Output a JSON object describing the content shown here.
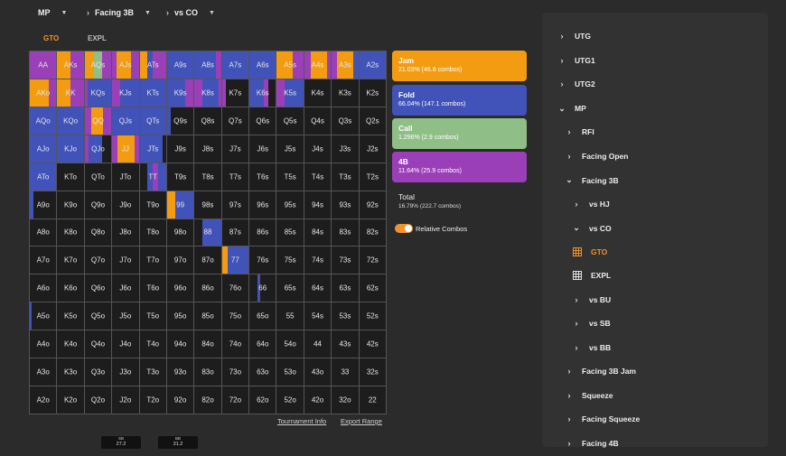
{
  "header": {
    "position": "MP",
    "scenario": "Facing 3B",
    "villain": "vs CO"
  },
  "tabs": [
    {
      "label": "GTO",
      "active": true
    },
    {
      "label": "EXPL",
      "active": false
    }
  ],
  "grid": {
    "rows": [
      [
        "AA",
        "AKs",
        "AQs",
        "AJs",
        "ATs",
        "A9s",
        "A8s",
        "A7s",
        "A6s",
        "A5s",
        "A4s",
        "A3s",
        "A2s"
      ],
      [
        "AKo",
        "KK",
        "KQs",
        "KJs",
        "KTs",
        "K9s",
        "K8s",
        "K7s",
        "K6s",
        "K5s",
        "K4s",
        "K3s",
        "K2s"
      ],
      [
        "AQo",
        "KQo",
        "QQ",
        "QJs",
        "QTs",
        "Q9s",
        "Q8s",
        "Q7s",
        "Q6s",
        "Q5s",
        "Q4s",
        "Q3s",
        "Q2s"
      ],
      [
        "AJo",
        "KJo",
        "QJo",
        "JJ",
        "JTs",
        "J9s",
        "J8s",
        "J7s",
        "J6s",
        "J5s",
        "J4s",
        "J3s",
        "J2s"
      ],
      [
        "ATo",
        "KTo",
        "QTo",
        "JTo",
        "TT",
        "T9s",
        "T8s",
        "T7s",
        "T6s",
        "T5s",
        "T4s",
        "T3s",
        "T2s"
      ],
      [
        "A9o",
        "K9o",
        "Q9o",
        "J9o",
        "T9o",
        "99",
        "98s",
        "97s",
        "96s",
        "95s",
        "94s",
        "93s",
        "92s"
      ],
      [
        "A8o",
        "K8o",
        "Q8o",
        "J8o",
        "T8o",
        "98o",
        "88",
        "87s",
        "86s",
        "85s",
        "84s",
        "83s",
        "82s"
      ],
      [
        "A7o",
        "K7o",
        "Q7o",
        "J7o",
        "T7o",
        "97o",
        "87o",
        "77",
        "76s",
        "75s",
        "74s",
        "73s",
        "72s"
      ],
      [
        "A6o",
        "K6o",
        "Q6o",
        "J6o",
        "T6o",
        "96o",
        "86o",
        "76o",
        "66",
        "65s",
        "64s",
        "63s",
        "62s"
      ],
      [
        "A5o",
        "K5o",
        "Q5o",
        "J5o",
        "T5o",
        "95o",
        "85o",
        "75o",
        "65o",
        "55",
        "54s",
        "53s",
        "52s"
      ],
      [
        "A4o",
        "K4o",
        "Q4o",
        "J4o",
        "T4o",
        "94o",
        "84o",
        "74o",
        "64o",
        "54o",
        "44",
        "43s",
        "42s"
      ],
      [
        "A3o",
        "K3o",
        "Q3o",
        "J3o",
        "T3o",
        "93o",
        "83o",
        "73o",
        "63o",
        "53o",
        "43o",
        "33",
        "32s"
      ],
      [
        "A2o",
        "K2o",
        "Q2o",
        "J2o",
        "T2o",
        "92o",
        "82o",
        "72o",
        "62o",
        "52o",
        "42o",
        "32o",
        "22"
      ]
    ],
    "frequencies": {
      "AA": [
        [
          "4b",
          1
        ]
      ],
      "AKs": [
        [
          "jam",
          0.5
        ],
        [
          "4b",
          0.5
        ]
      ],
      "AQs": [
        [
          "jam",
          0.35
        ],
        [
          "call",
          0.3
        ],
        [
          "4b",
          0.35
        ]
      ],
      "AJs": [
        [
          "4b",
          0.15
        ],
        [
          "jam",
          0.55
        ],
        [
          "4b",
          0.3
        ]
      ],
      "ATs": [
        [
          "jam",
          0.3
        ],
        [
          "fold",
          0.2
        ],
        [
          "4b",
          0.5
        ]
      ],
      "A9s": [
        [
          "fold",
          1
        ]
      ],
      "A8s": [
        [
          "fold",
          0.8
        ],
        [
          "4b",
          0.2
        ]
      ],
      "A7s": [
        [
          "fold",
          1
        ]
      ],
      "A6s": [
        [
          "fold",
          1
        ]
      ],
      "A5s": [
        [
          "jam",
          0.6
        ],
        [
          "4b",
          0.4
        ]
      ],
      "A4s": [
        [
          "4b",
          0.25
        ],
        [
          "jam",
          0.6
        ],
        [
          "4b",
          0.15
        ]
      ],
      "A3s": [
        [
          "4b",
          0.2
        ],
        [
          "jam",
          0.6
        ],
        [
          "fold",
          0.2
        ]
      ],
      "A2s": [
        [
          "fold",
          1
        ]
      ],
      "AKo": [
        [
          "jam",
          0.7
        ],
        [
          "4b",
          0.3
        ]
      ],
      "KK": [
        [
          "jam",
          0.5
        ],
        [
          "4b",
          0.5
        ]
      ],
      "KQs": [
        [
          "4b",
          0.1
        ],
        [
          "fold",
          0.9
        ]
      ],
      "KJs": [
        [
          "4b",
          0.3
        ],
        [
          "fold",
          0.7
        ]
      ],
      "KTs": [
        [
          "fold",
          1
        ]
      ],
      "K9s": [
        [
          "fold",
          0.7
        ],
        [
          "4b",
          0.3
        ]
      ],
      "K8s": [
        [
          "4b",
          0.3
        ],
        [
          "fold",
          0.6
        ],
        [
          "4b",
          0.1
        ]
      ],
      "K7s": [
        [
          "4b",
          0.15
        ],
        [
          "none",
          0.85
        ]
      ],
      "K6s": [
        [
          "fold",
          0.55
        ],
        [
          "4b",
          0.15
        ],
        [
          "none",
          0.3
        ]
      ],
      "K5s": [
        [
          "4b",
          0.3
        ],
        [
          "fold",
          0.7
        ]
      ],
      "AQo": [
        [
          "fold",
          1
        ]
      ],
      "KQo": [
        [
          "fold",
          1
        ]
      ],
      "QQ": [
        [
          "4b",
          0.25
        ],
        [
          "jam",
          0.45
        ],
        [
          "4b",
          0.3
        ]
      ],
      "QJs": [
        [
          "fold",
          1
        ]
      ],
      "QTs": [
        [
          "fold",
          1
        ]
      ],
      "Q9s": [
        [
          "fold",
          0.15
        ],
        [
          "none",
          0.85
        ]
      ],
      "AJo": [
        [
          "fold",
          1
        ]
      ],
      "KJo": [
        [
          "fold",
          1
        ]
      ],
      "QJo": [
        [
          "4b",
          0.15
        ],
        [
          "fold",
          0.5
        ],
        [
          "none",
          0.35
        ]
      ],
      "JJ": [
        [
          "4b",
          0.2
        ],
        [
          "jam",
          0.65
        ],
        [
          "4b",
          0.15
        ]
      ],
      "JTs": [
        [
          "fold",
          0.85
        ],
        [
          "none",
          0.15
        ]
      ],
      "ATo": [
        [
          "fold",
          1
        ]
      ],
      "TT": [
        [
          "none",
          0.3
        ],
        [
          "fold",
          0.2
        ],
        [
          "4b",
          0.2
        ],
        [
          "fold",
          0.3
        ]
      ],
      "A9o": [
        [
          "fold",
          0.15
        ],
        [
          "none",
          0.85
        ]
      ],
      "99": [
        [
          "jam",
          0.3
        ],
        [
          "fold",
          0.7
        ]
      ],
      "88": [
        [
          "none",
          0.3
        ],
        [
          "fold",
          0.7
        ]
      ],
      "77": [
        [
          "jam",
          0.2
        ],
        [
          "fold",
          0.8
        ]
      ],
      "66": [
        [
          "none",
          0.3
        ],
        [
          "fold",
          0.1
        ],
        [
          "none",
          0.6
        ]
      ],
      "A5o": [
        [
          "fold",
          0.08
        ],
        [
          "none",
          0.92
        ]
      ]
    }
  },
  "links": {
    "tournament_info": "Tournament Info",
    "export_range": "Export Range"
  },
  "actions": [
    {
      "name": "Jam",
      "value": "21.03% (46.8 combos)",
      "color": "#f39c12"
    },
    {
      "name": "Fold",
      "value": "66.04% (147.1 combos)",
      "color": "#4152b8"
    },
    {
      "name": "Call",
      "value": "1.296% (2.9 combos)",
      "color": "#8fbf87"
    },
    {
      "name": "4B",
      "value": "11.64% (25.9 combos)",
      "color": "#9b3fb8"
    }
  ],
  "total": {
    "label": "Total",
    "value": "16.79% (222.7 combos)"
  },
  "relative_combos": {
    "label": "Relative Combos",
    "enabled": true
  },
  "stacks": [
    {
      "pos": "SB",
      "amount": "27.2"
    },
    {
      "pos": "BB",
      "amount": "31.2"
    }
  ],
  "sidebar": {
    "items": [
      {
        "label": "UTG",
        "icon": "chevron-right",
        "indent": 0
      },
      {
        "label": "UTG1",
        "icon": "chevron-right",
        "indent": 0
      },
      {
        "label": "UTG2",
        "icon": "chevron-right",
        "indent": 0
      },
      {
        "label": "MP",
        "icon": "chevron-down",
        "indent": 0
      },
      {
        "label": "RFI",
        "icon": "chevron-right",
        "indent": 1
      },
      {
        "label": "Facing Open",
        "icon": "chevron-right",
        "indent": 1
      },
      {
        "label": "Facing 3B",
        "icon": "chevron-down",
        "indent": 1
      },
      {
        "label": "vs HJ",
        "icon": "chevron-right",
        "indent": 2
      },
      {
        "label": "vs CO",
        "icon": "chevron-down",
        "indent": 2
      },
      {
        "label": "GTO",
        "icon": "grid",
        "indent": 3,
        "active": true
      },
      {
        "label": "EXPL",
        "icon": "grid",
        "indent": 3
      },
      {
        "label": "vs BU",
        "icon": "chevron-right",
        "indent": 2
      },
      {
        "label": "vs SB",
        "icon": "chevron-right",
        "indent": 2
      },
      {
        "label": "vs BB",
        "icon": "chevron-right",
        "indent": 2
      },
      {
        "label": "Facing 3B Jam",
        "icon": "chevron-right",
        "indent": 1
      },
      {
        "label": "Squeeze",
        "icon": "chevron-right",
        "indent": 1
      },
      {
        "label": "Facing Squeeze",
        "icon": "chevron-right",
        "indent": 1
      },
      {
        "label": "Facing 4B",
        "icon": "chevron-right",
        "indent": 1
      }
    ]
  },
  "colors": {
    "jam": "#f39c12",
    "fold": "#4152b8",
    "call": "#8fbf87",
    "4b": "#9b3fb8",
    "none": "#1d1d1d",
    "accent": "#f0932b"
  }
}
